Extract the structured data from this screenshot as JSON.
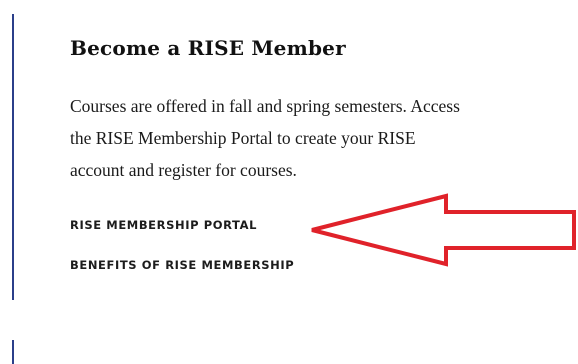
{
  "section": {
    "heading": "Become a RISE Member",
    "description_lines": [
      "Courses are offered in fall and spring semesters. Access",
      "the RISE Membership Portal to create your RISE",
      "account and register for courses."
    ],
    "links": {
      "portal": "RISE MEMBERSHIP PORTAL",
      "benefits": "BENEFITS OF RISE MEMBERSHIP"
    }
  },
  "colors": {
    "accent_border": "#2b3f8a",
    "annotation_arrow": "#e0222a"
  },
  "annotation": {
    "icon": "left-arrow-annotation-icon"
  }
}
